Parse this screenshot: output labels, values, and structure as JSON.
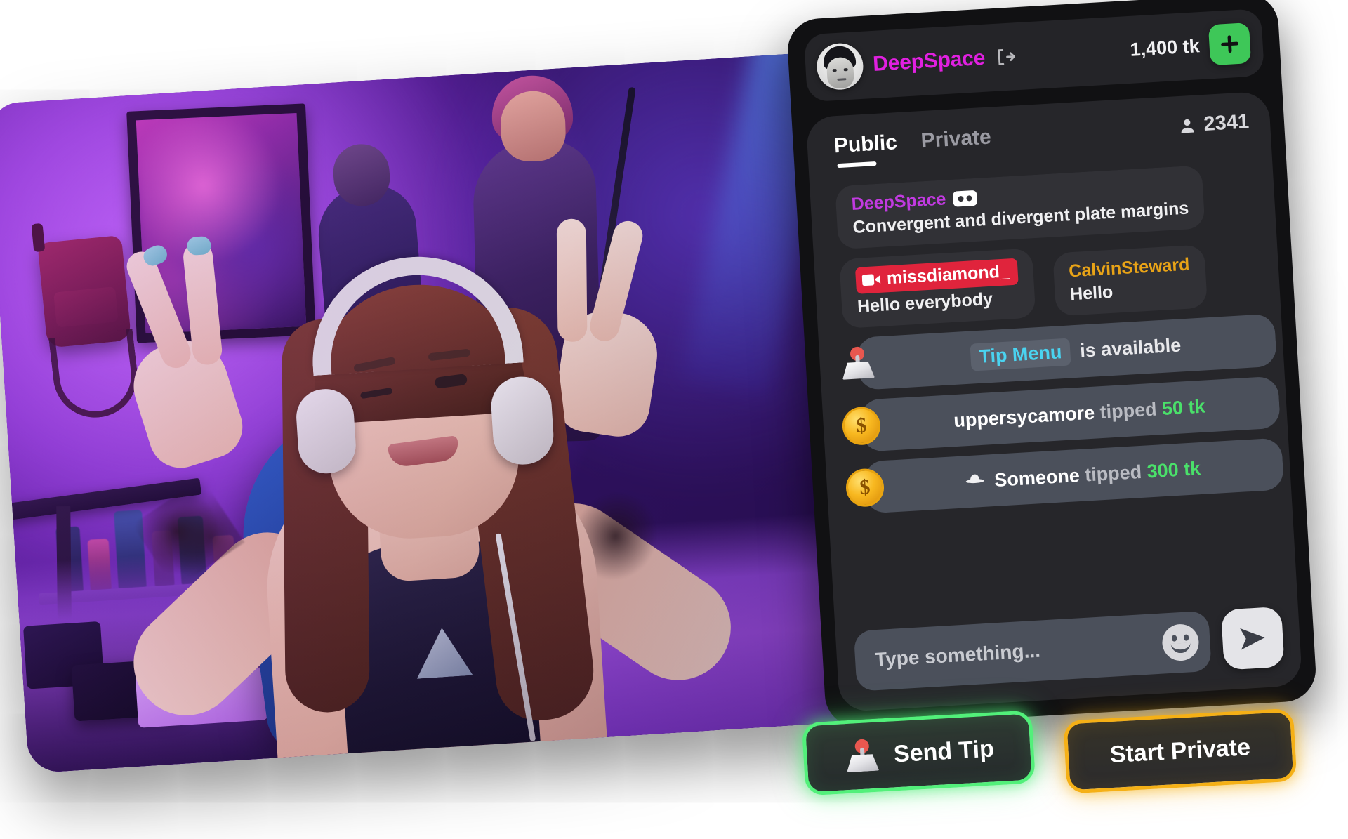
{
  "account": {
    "username": "DeepSpace",
    "avatar_alt": "user-avatar-photo",
    "logout_icon": "logout-icon",
    "token_balance": "1,400 tk",
    "add_tokens_icon": "plus-icon"
  },
  "chat": {
    "tabs": [
      {
        "label": "Public",
        "active": true
      },
      {
        "label": "Private",
        "active": false
      }
    ],
    "viewers_icon": "person-icon",
    "viewer_count": "2341",
    "messages": [
      {
        "kind": "user",
        "username": "DeepSpace",
        "name_color": "#c13ae0",
        "badge": "vr-goggles-badge",
        "text": "Convergent and divergent plate margins"
      },
      {
        "kind": "user",
        "username": "missdiamond_",
        "name_color": "#ffffff",
        "badge": "camera-badge",
        "badge_color": "#e0243c",
        "text": "Hello everybody"
      },
      {
        "kind": "user",
        "username": "CalvinSteward",
        "name_color": "#e8a317",
        "badge": null,
        "text": "Hello"
      },
      {
        "kind": "notice",
        "icon": "joystick-icon",
        "chip": "Tip Menu",
        "chip_color": "#4ad3f0",
        "text": "is available"
      },
      {
        "kind": "tip",
        "icon": "coin-icon",
        "who": "uppersycamore",
        "verb": "tipped",
        "amount": "50 tk"
      },
      {
        "kind": "tip",
        "icon": "coin-icon",
        "anon_icon": "spy-hat-icon",
        "who": "Someone",
        "verb": "tipped",
        "amount": "300 tk"
      }
    ],
    "composer": {
      "placeholder": "Type something...",
      "emoji_icon": "smiley-icon",
      "send_icon": "send-icon"
    }
  },
  "actions": {
    "send_tip": {
      "label": "Send Tip",
      "icon": "joystick-icon",
      "accent": "#52f07a"
    },
    "start_private": {
      "label": "Start Private",
      "accent": "#f5b016"
    }
  },
  "video": {
    "alt": "live-stream-video-preview"
  }
}
